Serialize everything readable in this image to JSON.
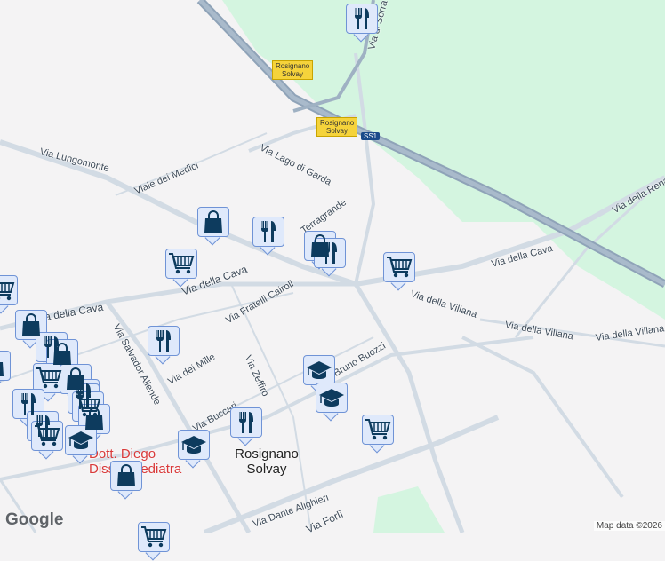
{
  "colors": {
    "park": "#d4f5e0",
    "road": "#d2dbe4",
    "highway": "#8fa3b8",
    "marker_bg": "#dfe9fb",
    "marker_icon": "#0d3b5e",
    "poi_red": "#d93a3a"
  },
  "streets": {
    "lungomonte": "Via Lungomonte",
    "medici": "Viale dei Medici",
    "lago_garda": "Via Lago di Garda",
    "terragrande": "Terragrande",
    "cava1": "Via della Cava",
    "cava2": "Via della Cava",
    "cava3": "Via della Cava",
    "cairoli": "Via Fratelli Cairoli",
    "allende": "Via Salvador Allende",
    "mille": "Via dei Mille",
    "zeffiro": "Via Zeffiro",
    "buccari": "Via Buccari",
    "buozzi": "Via Bruno Buozzi",
    "villana1": "Via della Villana",
    "villana2": "Via della Villana",
    "villana3": "Via della Villana",
    "rena": "Via della Rena",
    "serra": "Via di Serra",
    "alighieri": "Via Dante Alighieri",
    "forli": "Via Forlì"
  },
  "shields": {
    "a": "Rosignano Solvay",
    "b": "Rosignano Solvay",
    "route": "SS1"
  },
  "city": "Rosignano Solvay",
  "poi": "Dott. Diego Dissidi Pediatra",
  "google": "Google",
  "attribution": "Map data ©2026"
}
